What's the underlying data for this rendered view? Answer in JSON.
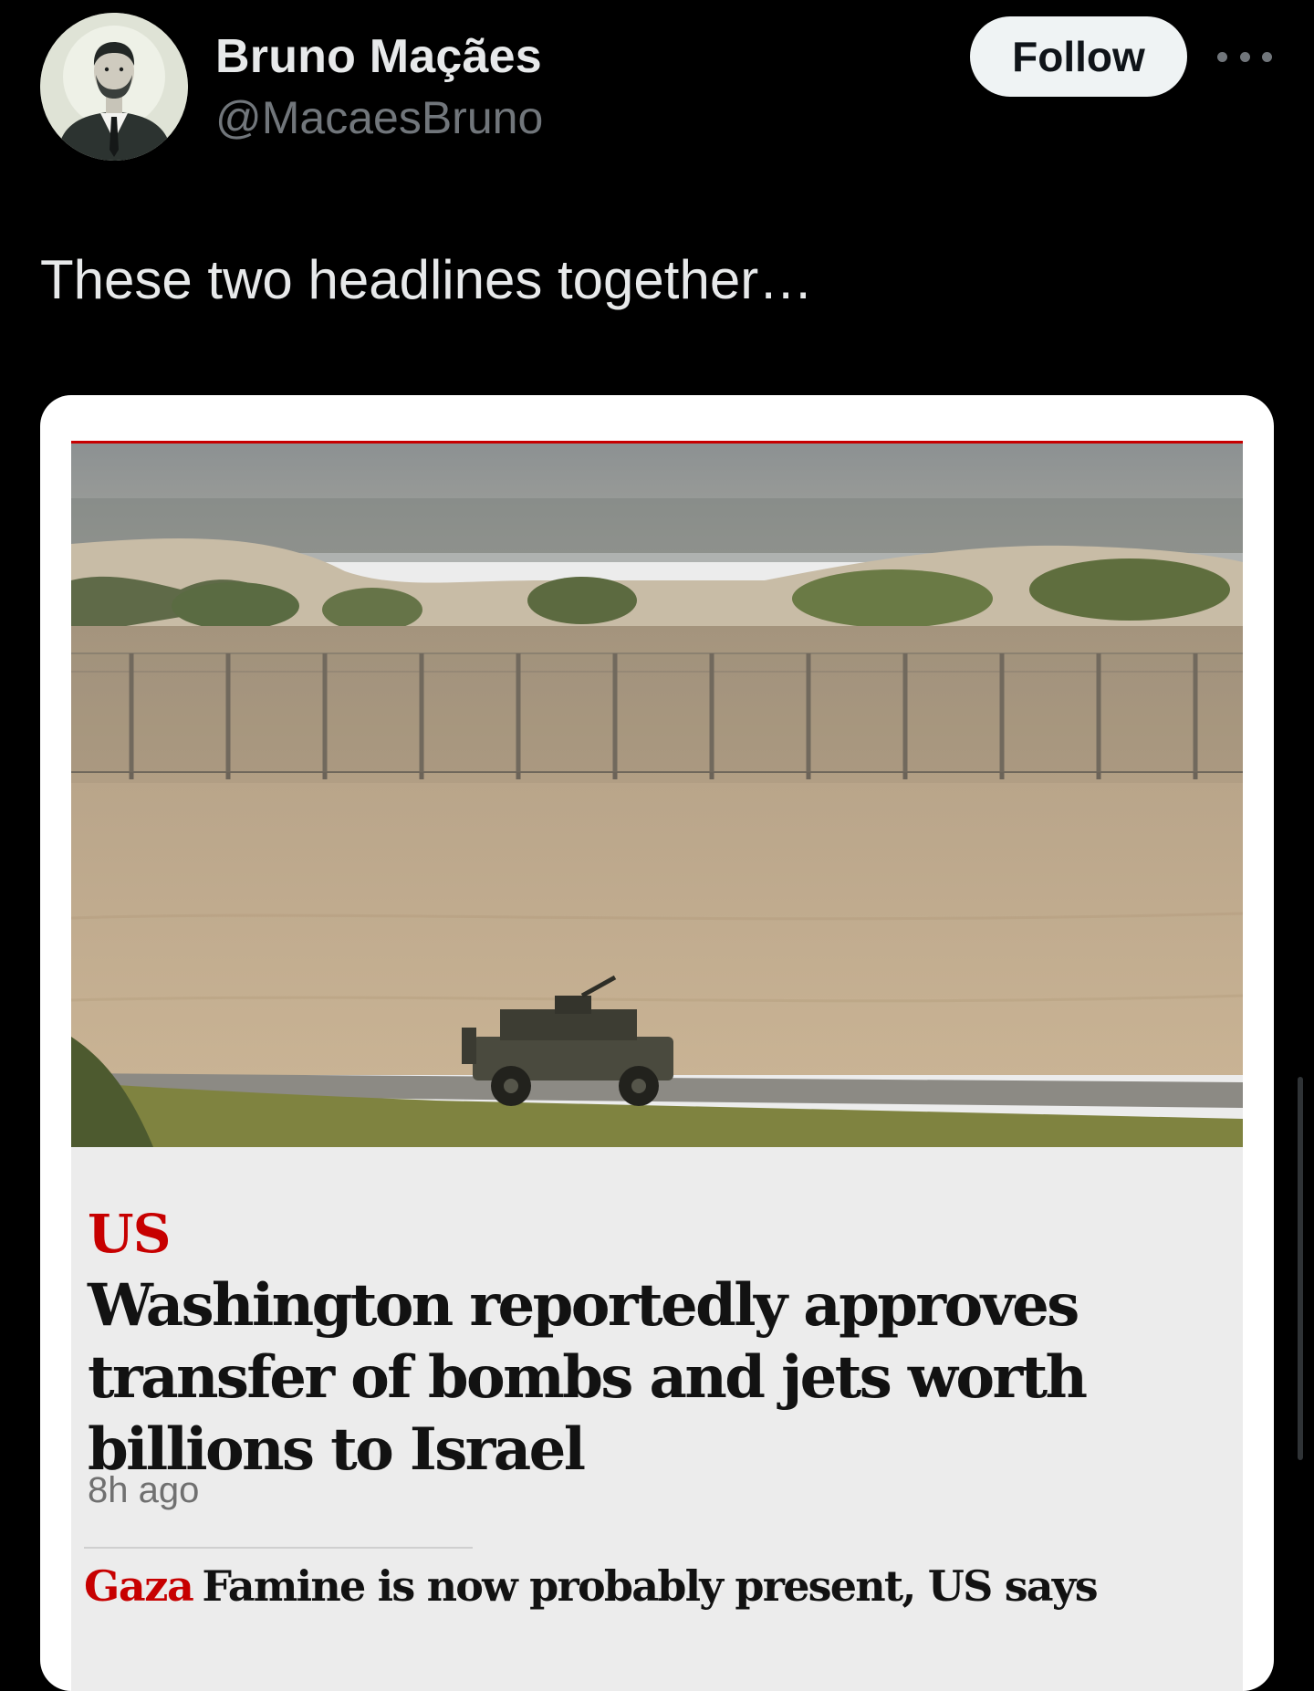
{
  "tweet": {
    "author": {
      "display_name": "Bruno Maçães",
      "handle": "@MacaesBruno",
      "avatar_icon": "profile-photo"
    },
    "follow_label": "Follow",
    "more_icon": "more-horizontal-icon",
    "text": "These two headlines together…"
  },
  "article": {
    "section": "US",
    "headline": "Washington reportedly approves transfer of bombs and jets worth billions to Israel",
    "time_ago": "8h ago",
    "photo": "military vehicle driving along a border road beside a tall fence, sand dunes and hazy town in background",
    "next_item": {
      "section": "Gaza",
      "headline": "Famine is now probably present, US says"
    }
  },
  "colors": {
    "background": "#000000",
    "accent_red": "#c70000",
    "handle_grey": "#71767b",
    "card_bg": "#ececec"
  }
}
